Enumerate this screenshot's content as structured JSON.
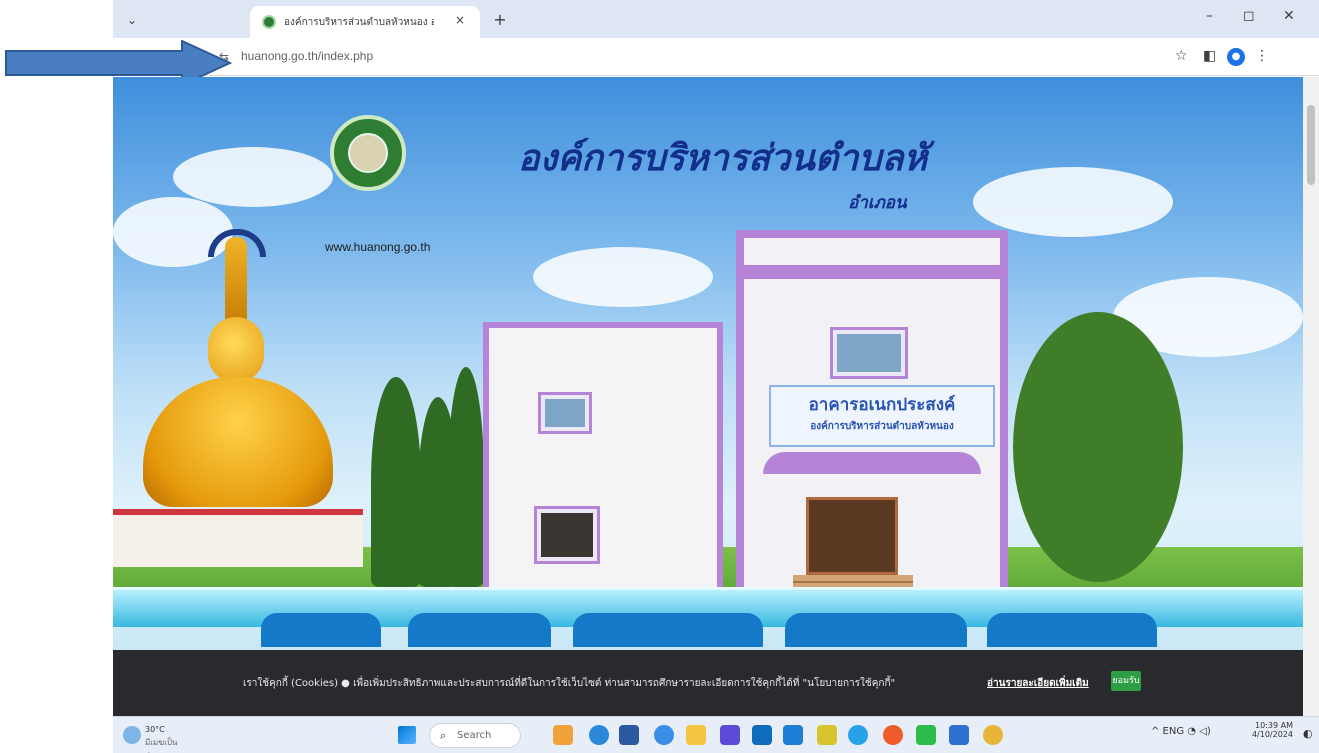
{
  "browser": {
    "tab_title": "องค์การบริหารส่วนตำบลหัวหนอง อำ",
    "new_tab": "+",
    "tab_close": "×",
    "tab_menu": "⌄",
    "url": "huanong.go.th/index.php",
    "site_info_icon": "⇆",
    "minimize": "–",
    "restore": "◻",
    "close": "✕",
    "bookmark_icon": "☆",
    "sidepanel_icon": "◧",
    "profile_icon": "●",
    "menu_icon": "⋮"
  },
  "header": {
    "domain": "www.huanong.go.th",
    "org_title": "องค์การบริหารส่วนตำบลหั",
    "org_subtitle": "อำเภอน"
  },
  "building_sign": {
    "line1": "อาคารอเนกประสงค์",
    "line2": "องค์การบริหารส่วนตำบลหัวหนอง"
  },
  "cookie_bar": {
    "text": "เราใช้คุกกี้ (Cookies) ● เพื่อเพิ่มประสิทธิภาพและประสบการณ์ที่ดีในการใช้เว็บไซต์ ท่านสามารถศึกษารายละเอียดการใช้คุกกี้ได้ที่ \"นโยบายการใช้คุกกี้\"",
    "link": "อ่านรายละเอียดเพิ่มเติม",
    "accept": "ยอมรับ"
  },
  "taskbar": {
    "weather_temp": "30°C",
    "weather_desc": "มีเมฆเป็นส่วน",
    "search_label": "Search",
    "search_icon": "⌕",
    "tray": "^  ENG  ◔  ◁)",
    "time": "10:39 AM",
    "date": "4/10/2024",
    "notification_icon": "◐"
  },
  "colors": {
    "accent": "#1479c8",
    "title_blue": "#132f8c",
    "building_purple": "#b584d8",
    "arrow_blue": "#4a7ec2"
  }
}
